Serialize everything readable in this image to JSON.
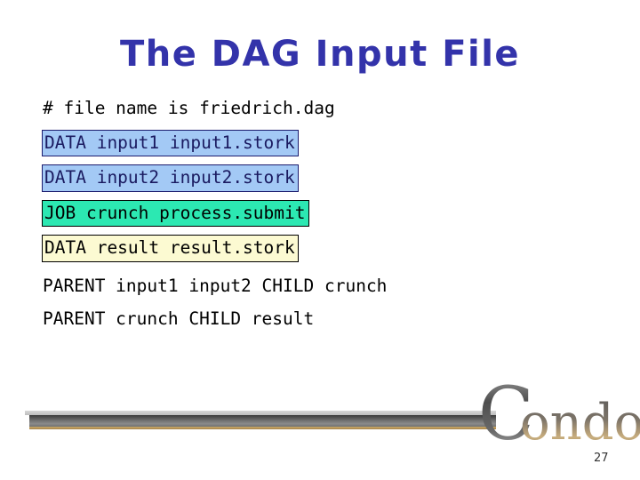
{
  "slide": {
    "title": "The DAG Input File",
    "page_number": "27",
    "title_color": "#3333aa",
    "background_color": "#ffffff"
  },
  "code_lines": [
    {
      "text": "# file name is friedrich.dag",
      "style": "plain",
      "background": "none",
      "text_color": "#000000"
    },
    {
      "text": "DATA input1 input1.stork",
      "style": "boxed",
      "background": "#a3c9f5",
      "border_color": "#1c1c6e",
      "text_color": "#1a1a60"
    },
    {
      "text": "DATA input2 input2.stork",
      "style": "boxed",
      "background": "#a3c9f5",
      "border_color": "#1c1c6e",
      "text_color": "#1a1a60"
    },
    {
      "text": "JOB crunch process.submit",
      "style": "boxed",
      "background": "#2ce8b2",
      "border_color": "#000000",
      "text_color": "#000000"
    },
    {
      "text": "DATA result result.stork",
      "style": "boxed",
      "background": "#fcfad2",
      "border_color": "#000000",
      "text_color": "#000000"
    },
    {
      "text": "PARENT input1 input2 CHILD crunch",
      "style": "plain",
      "background": "none",
      "text_color": "#000000"
    },
    {
      "text": "PARENT crunch CHILD result",
      "style": "plain",
      "background": "none",
      "text_color": "#000000"
    }
  ],
  "footer": {
    "logo_text": "Condor",
    "logo_initial": "C",
    "logo_rest": "ondor",
    "bar_color": "#6e6e6e",
    "bar_accent_color": "#a8854a"
  }
}
